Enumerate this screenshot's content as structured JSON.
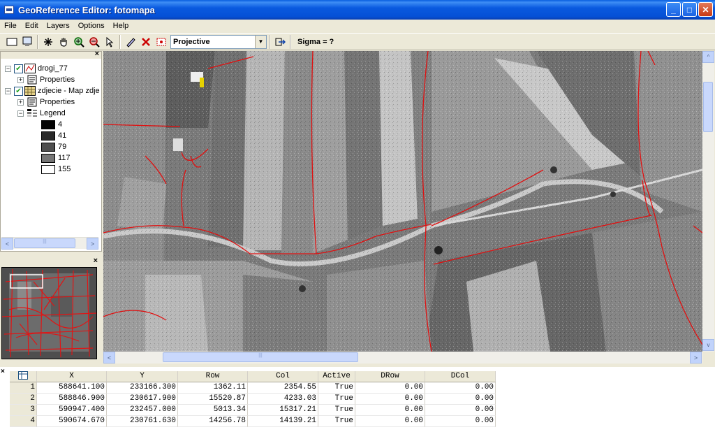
{
  "window": {
    "title": "GeoReference Editor: fotomapa",
    "minimize": "_",
    "maximize": "□",
    "close": "✕"
  },
  "menu": [
    {
      "label": "File"
    },
    {
      "label": "Edit"
    },
    {
      "label": "Layers"
    },
    {
      "label": "Options"
    },
    {
      "label": "Help"
    }
  ],
  "toolbar": {
    "transform_select": "Projective",
    "sigma_label": "Sigma = ?",
    "icons": [
      "new-map-icon",
      "show-all-icon",
      "add-point-icon",
      "pan-hand-icon",
      "zoom-in-icon",
      "zoom-out-icon",
      "select-pointer-icon",
      "edit-point-icon",
      "delete-point-icon",
      "recalculate-icon",
      "exit-icon"
    ]
  },
  "layers": {
    "close": "×",
    "tree": [
      {
        "label": "drogi_77",
        "level": 0,
        "expander": "−",
        "checked": true
      },
      {
        "label": "Properties",
        "level": 1,
        "expander": "+"
      },
      {
        "label": "zdjecie - Map zdje",
        "level": 0,
        "expander": "−",
        "checked": true
      },
      {
        "label": "Properties",
        "level": 1,
        "expander": "+"
      },
      {
        "label": "Legend",
        "level": 1,
        "expander": "−"
      }
    ],
    "legend": [
      {
        "value": "4",
        "color": "#040404"
      },
      {
        "value": "41",
        "color": "#292929"
      },
      {
        "value": "79",
        "color": "#4f4f4f"
      },
      {
        "value": "117",
        "color": "#757575"
      },
      {
        "value": "155",
        "color": "#ffffff"
      }
    ]
  },
  "overview": {
    "close": "×"
  },
  "table": {
    "close": "×",
    "columns": [
      "X",
      "Y",
      "Row",
      "Col",
      "Active",
      "DRow",
      "DCol"
    ],
    "rows": [
      {
        "n": "1",
        "x": "588641.100",
        "y": "233166.300",
        "row": "1362.11",
        "col": "2354.55",
        "active": "True",
        "drow": "0.00",
        "dcol": "0.00"
      },
      {
        "n": "2",
        "x": "588846.900",
        "y": "230617.900",
        "row": "15520.87",
        "col": "4233.03",
        "active": "True",
        "drow": "0.00",
        "dcol": "0.00"
      },
      {
        "n": "3",
        "x": "590947.400",
        "y": "232457.000",
        "row": "5013.34",
        "col": "15317.21",
        "active": "True",
        "drow": "0.00",
        "dcol": "0.00"
      },
      {
        "n": "4",
        "x": "590674.670",
        "y": "230761.630",
        "row": "14256.78",
        "col": "14139.21",
        "active": "True",
        "drow": "0.00",
        "dcol": "0.00"
      }
    ]
  },
  "scroll": {
    "left": "<",
    "right": ">",
    "up": "^",
    "down": "v",
    "grip": "|||"
  }
}
